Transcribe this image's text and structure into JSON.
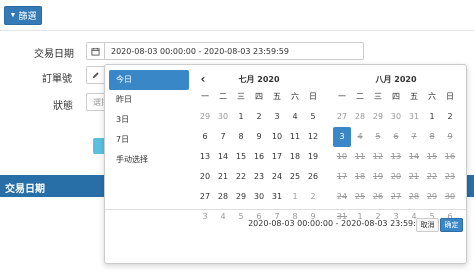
{
  "toolbar": {
    "filter_label": "篩選"
  },
  "form": {
    "date_label": "交易日期",
    "date_value": "2020-08-03 00:00:00 - 2020-08-03 23:59:59",
    "order_label": "訂單號",
    "status_label": "狀態",
    "status_placeholder": "選擇"
  },
  "section": {
    "title": "交易日期"
  },
  "picker": {
    "ranges": [
      "今日",
      "昨日",
      "3日",
      "7日",
      "手动选择"
    ],
    "active_range": "今日",
    "weekdays": [
      "一",
      "二",
      "三",
      "四",
      "五",
      "六",
      "日"
    ],
    "left_month": "七月 2020",
    "right_month": "八月 2020",
    "left_days": [
      [
        "29",
        "30",
        "1",
        "2",
        "3",
        "4",
        "5"
      ],
      [
        "6",
        "7",
        "8",
        "9",
        "10",
        "11",
        "12"
      ],
      [
        "13",
        "14",
        "15",
        "16",
        "17",
        "18",
        "19"
      ],
      [
        "20",
        "21",
        "22",
        "23",
        "24",
        "25",
        "26"
      ],
      [
        "27",
        "28",
        "29",
        "30",
        "31",
        "1",
        "2"
      ],
      [
        "3",
        "4",
        "5",
        "6",
        "7",
        "8",
        "9"
      ]
    ],
    "right_days": [
      [
        "27",
        "28",
        "29",
        "30",
        "31",
        "1",
        "2"
      ],
      [
        "3",
        "4",
        "5",
        "6",
        "7",
        "8",
        "9"
      ],
      [
        "10",
        "11",
        "12",
        "13",
        "14",
        "15",
        "16"
      ],
      [
        "17",
        "18",
        "19",
        "20",
        "21",
        "22",
        "23"
      ],
      [
        "24",
        "25",
        "26",
        "27",
        "28",
        "29",
        "30"
      ],
      [
        "31",
        "1",
        "2",
        "3",
        "4",
        "5",
        "6"
      ]
    ],
    "selected_day": "3",
    "range_text": "2020-08-03 00:00:00 - 2020-08-03 23:59:59",
    "cancel_label": "取消",
    "apply_label": "确定",
    "accent_color": "#3a87c8"
  }
}
